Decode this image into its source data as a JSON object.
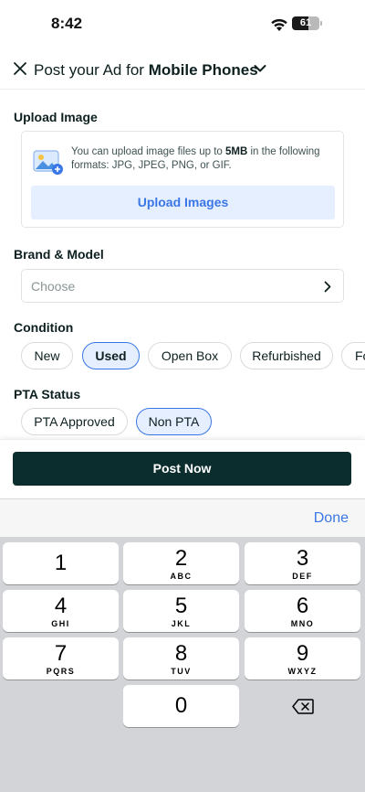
{
  "status_bar": {
    "time": "8:42",
    "battery": "61",
    "battery_level_pct": 61
  },
  "header": {
    "title_prefix": "Post your Ad for ",
    "category": "Mobile Phones"
  },
  "upload": {
    "label": "Upload Image",
    "info_prefix": "You can upload image files up to ",
    "info_size": "5MB",
    "info_suffix": " in the following formats: JPG, JPEG, PNG, or GIF.",
    "button": "Upload Images"
  },
  "brand_model": {
    "label": "Brand & Model",
    "placeholder": "Choose"
  },
  "condition": {
    "label": "Condition",
    "options": [
      "New",
      "Used",
      "Open Box",
      "Refurbished",
      "Fo"
    ],
    "selected": "Used"
  },
  "pta_status": {
    "label": "PTA Status",
    "options": [
      "PTA Approved",
      "Non PTA"
    ],
    "selected": "Non PTA"
  },
  "post_button": "Post Now",
  "keyboard": {
    "done": "Done",
    "keys": [
      {
        "num": "1",
        "letters": ""
      },
      {
        "num": "2",
        "letters": "ABC"
      },
      {
        "num": "3",
        "letters": "DEF"
      },
      {
        "num": "4",
        "letters": "GHI"
      },
      {
        "num": "5",
        "letters": "JKL"
      },
      {
        "num": "6",
        "letters": "MNO"
      },
      {
        "num": "7",
        "letters": "PQRS"
      },
      {
        "num": "8",
        "letters": "TUV"
      },
      {
        "num": "9",
        "letters": "WXYZ"
      },
      {
        "num": "0",
        "letters": ""
      }
    ]
  },
  "colors": {
    "accent": "#3a77e6",
    "primary_dark": "#0c2d2d",
    "chip_selected_bg": "#e6efff",
    "keyboard_bg": "#d2d4d8"
  }
}
